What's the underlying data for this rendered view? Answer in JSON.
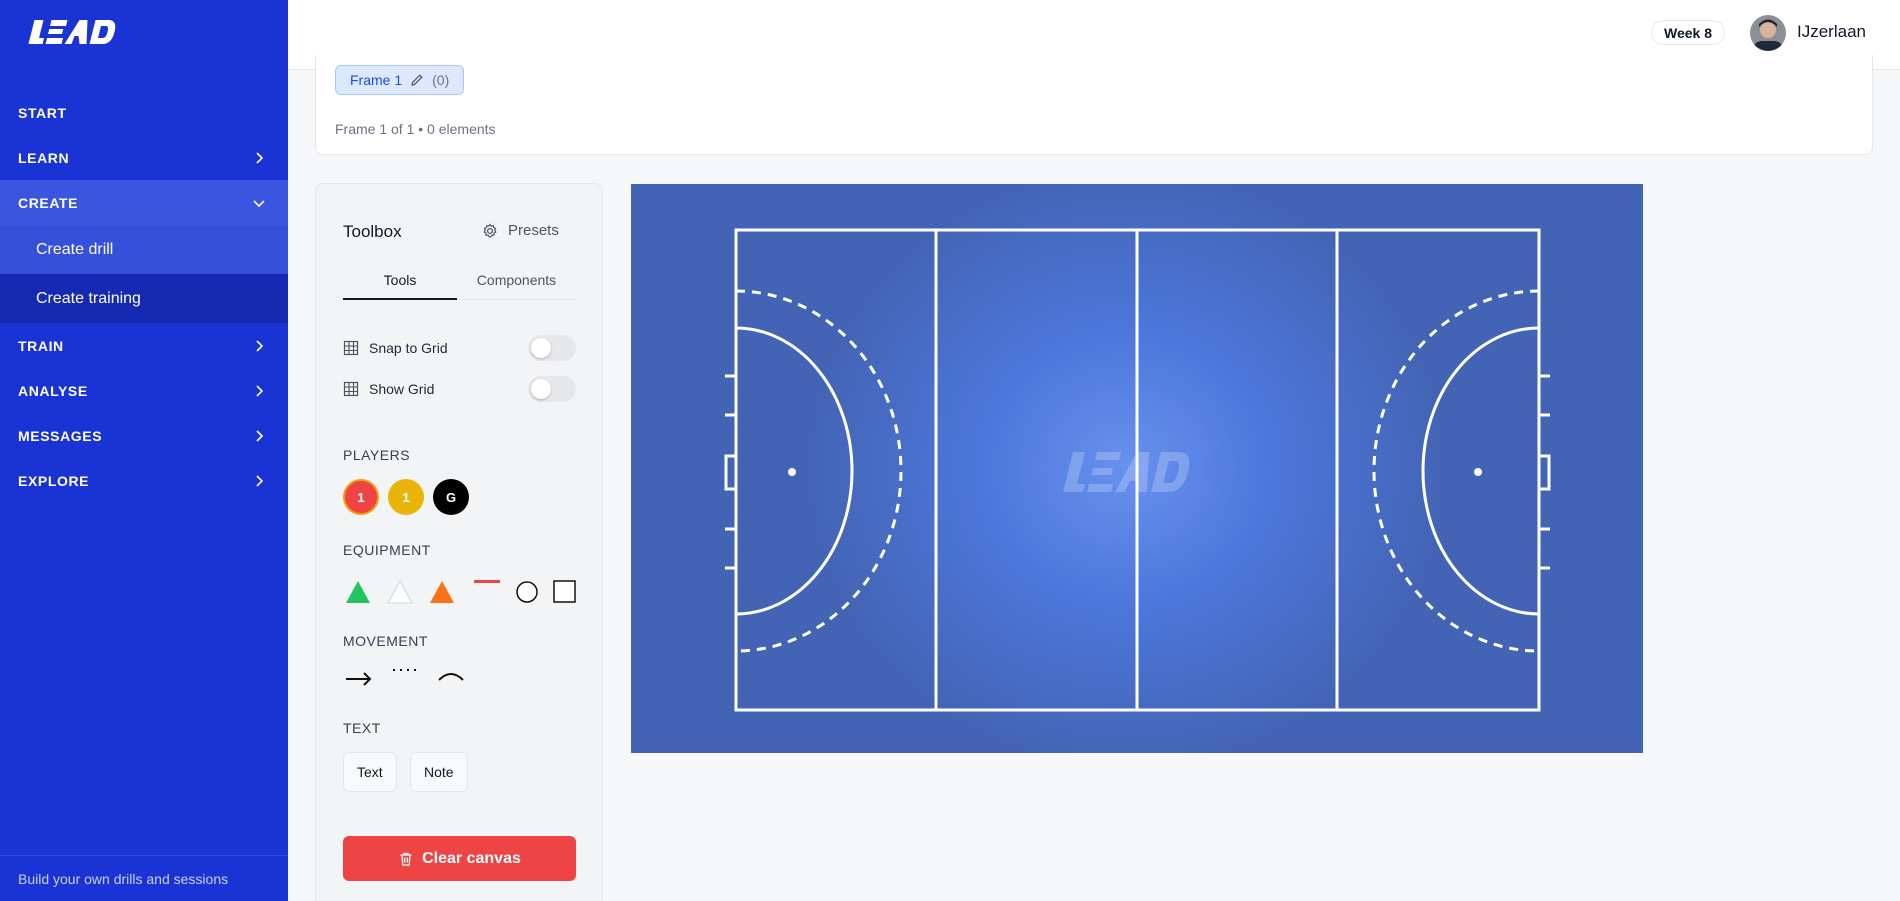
{
  "app": {
    "brand": "LEAD"
  },
  "sidebar": {
    "nav": [
      {
        "label": "START",
        "has_chevron": false
      },
      {
        "label": "LEARN",
        "has_chevron": true
      },
      {
        "label": "CREATE",
        "has_chevron": true,
        "expanded": true
      },
      {
        "label": "TRAIN",
        "has_chevron": true
      },
      {
        "label": "ANALYSE",
        "has_chevron": true
      },
      {
        "label": "MESSAGES",
        "has_chevron": true
      },
      {
        "label": "EXPLORE",
        "has_chevron": true
      }
    ],
    "create_sub": [
      "Create drill",
      "Create training"
    ],
    "footer": "Build your own drills and sessions"
  },
  "topbar": {
    "week": "Week 8",
    "user": "IJzerlaan"
  },
  "frames": {
    "chip_label": "Frame 1",
    "chip_count": "(0)",
    "info": "Frame 1 of 1 • 0 elements"
  },
  "toolbox": {
    "title": "Toolbox",
    "presets": "Presets",
    "tabs": [
      "Tools",
      "Components"
    ],
    "active_tab": "Tools",
    "snap_to_grid": "Snap to Grid",
    "show_grid": "Show Grid",
    "snap_on": false,
    "grid_on": false,
    "players_label": "PLAYERS",
    "players": [
      {
        "label": "1",
        "color": "#ef4444",
        "ring": "#f59e0b"
      },
      {
        "label": "1",
        "color": "#eab308"
      },
      {
        "label": "G",
        "color": "#000000"
      }
    ],
    "equipment_label": "EQUIPMENT",
    "equipment": [
      "green-cone-icon",
      "white-cone-icon",
      "orange-cone-icon",
      "red-marker-icon",
      "circle-icon",
      "square-icon"
    ],
    "movement_label": "MOVEMENT",
    "movement": [
      "arrow-right-icon",
      "dotted-line-icon",
      "curve-icon"
    ],
    "text_label": "TEXT",
    "text_buttons": [
      "Text",
      "Note"
    ],
    "clear_label": "Clear canvas"
  },
  "colors": {
    "sidebar": "#1a33d4",
    "pitch": "#4364b4",
    "danger": "#ef4444",
    "accent_chip": "#dbe8fe"
  }
}
